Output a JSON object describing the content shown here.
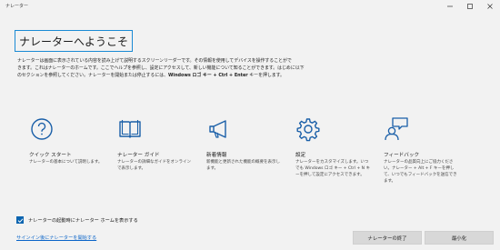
{
  "window": {
    "title": "ナレーター",
    "controls": [
      "minimize-icon",
      "maximize-icon",
      "close-icon"
    ]
  },
  "heading": "ナレーターへようこそ",
  "intro": {
    "line1": "ナレーターは画面に表示されている内容を読み上げて説明するスクリーンリーダーです。その情報を使用してデバイスを操作することがで",
    "line2": "きます。これはナレーターのホームです。ここでヘルプを参照し、設定にアクセスして、新しい機能について知ることができます。はじめに以下",
    "line3_start": "のセクションを参照してください。ナレーターを開始または停止するには、",
    "line3_bold": "Windows ロゴ キー + Ctrl + Enter",
    "line3_end": " キーを押します。"
  },
  "features": [
    {
      "icon": "question-icon",
      "title": "クイック スタート",
      "desc": "ナレーターの基本について説明します。"
    },
    {
      "icon": "book-icon",
      "title": "ナレーター ガイド",
      "desc": "ナレーターの詳細なガイドをオンラインで表示します。"
    },
    {
      "icon": "megaphone-icon",
      "title": "新着情報",
      "desc": "新機能と更新された機能の概要を表示します。"
    },
    {
      "icon": "gear-icon",
      "title": "設定",
      "desc": "ナレーターをカスタマイズします。いつでも Windows ロゴ キー + Ctrl + N キーを押して設定にアクセスできます。"
    },
    {
      "icon": "feedback-icon",
      "title": "フィードバック",
      "desc": "ナレーターの品質向上にご協力ください。ナレーター + Alt + F キーを押して、いつでもフィードバックを送信できます。"
    }
  ],
  "checkbox": {
    "label": "ナレーターの起動時にナレーター ホームを表示する",
    "checked": true
  },
  "signin_link": "サインイン後にナレーターを開始する",
  "buttons": {
    "exit": "ナレーターの終了",
    "minimize": "最小化"
  },
  "colors": {
    "accent": "#0a64b0",
    "link": "#0a64c8",
    "heading_border": "#1a8ad4"
  }
}
